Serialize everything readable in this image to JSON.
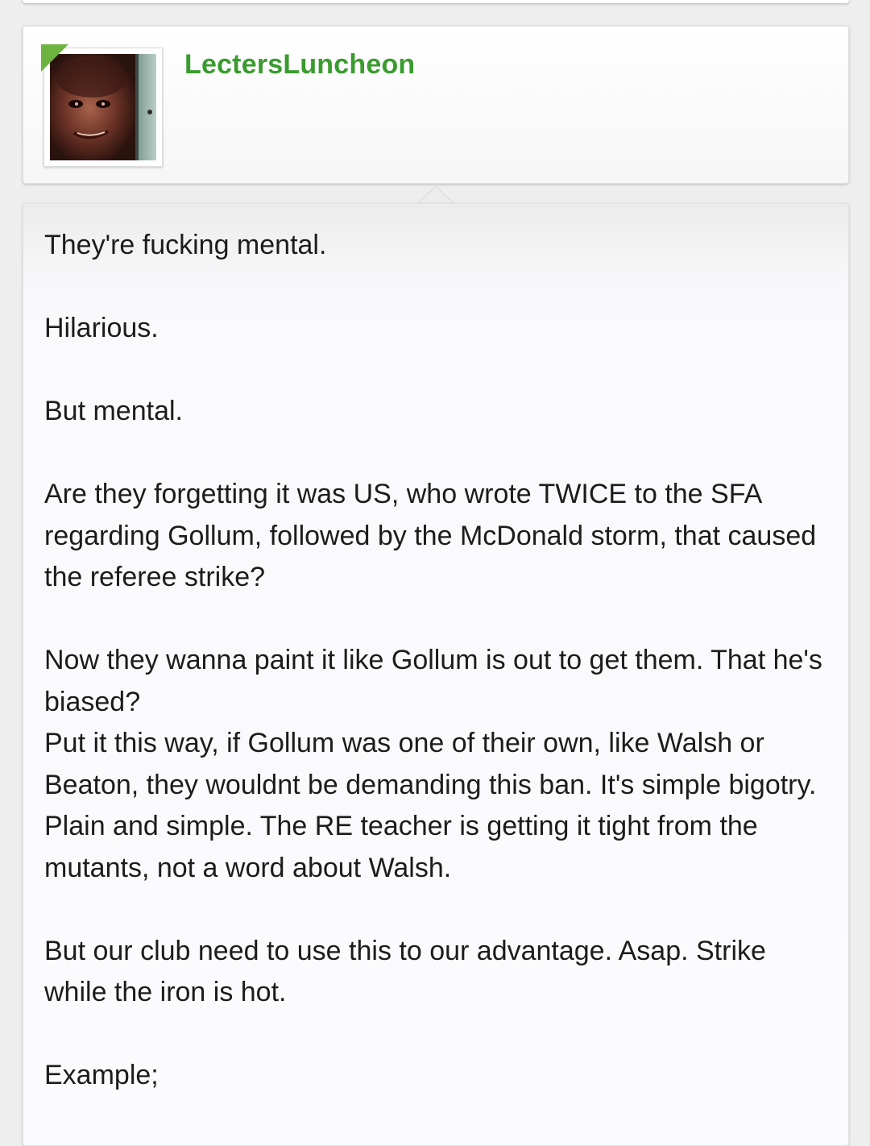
{
  "user": {
    "username": "LectersLuncheon",
    "avatar_icon": "user-avatar-photo",
    "status_color": "#6cb33f",
    "name_color": "#3a9b2f"
  },
  "post": {
    "paragraphs": [
      "They're fucking mental.",
      "Hilarious.",
      "But mental.",
      "Are they forgetting it was US, who wrote TWICE to the SFA regarding Gollum, followed by the McDonald storm, that caused the referee strike?",
      "Now they wanna paint it like Gollum is out to get them. That he's biased?",
      "Put it this way, if Gollum was one of their own, like Walsh or Beaton, they wouldnt be demanding this ban. It's simple bigotry. Plain and simple. The RE teacher is getting it tight from the mutants, not a word about Walsh.",
      "But our club need to use this to our advantage. Asap. Strike while the iron is hot.",
      "Example;"
    ]
  }
}
